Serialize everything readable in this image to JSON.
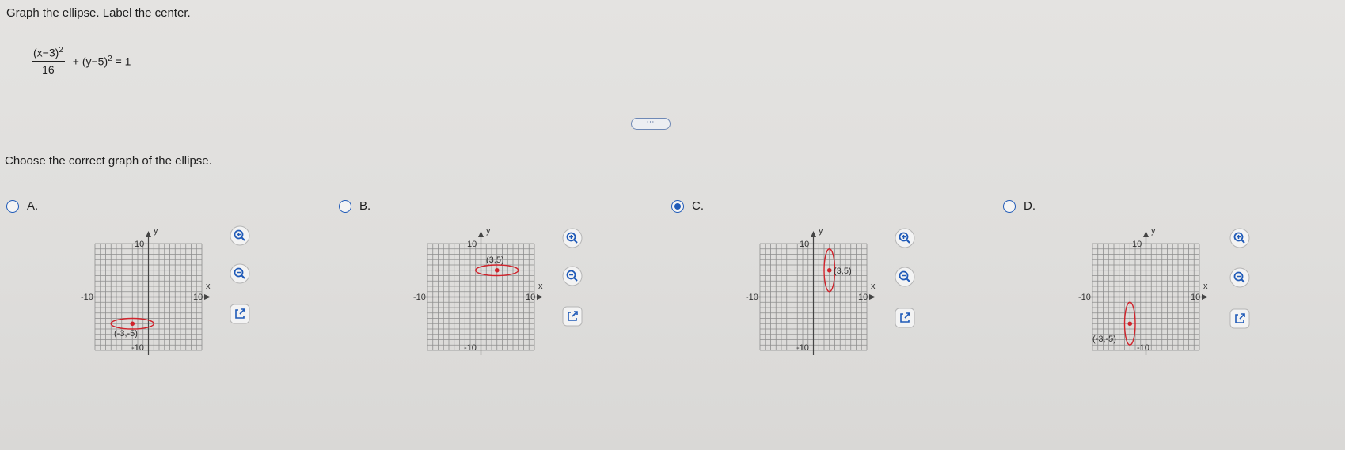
{
  "question": {
    "prompt": "Graph the ellipse. Label the center.",
    "equation": {
      "numerator": "(x−3)",
      "numerator_exp": "2",
      "denominator": "16",
      "rest": "+ (y−5)",
      "rest_exp": "2",
      "equals": "= 1"
    }
  },
  "more_button": "⋯",
  "instruction": "Choose the correct graph of the ellipse.",
  "options": [
    {
      "label": "A.",
      "selected": false,
      "center_label": "(-3,-5)",
      "ticks": {
        "top": "10",
        "bottom": "-10",
        "left": "-10",
        "right": "10"
      }
    },
    {
      "label": "B.",
      "selected": false,
      "center_label": "(3,5)",
      "ticks": {
        "top": "10",
        "bottom": "-10",
        "left": "-10",
        "right": "10"
      }
    },
    {
      "label": "C.",
      "selected": true,
      "center_label": "(3,5)",
      "ticks": {
        "top": "10",
        "bottom": "-10",
        "left": "-10",
        "right": "10"
      }
    },
    {
      "label": "D.",
      "selected": false,
      "center_label": "(-3,-5)",
      "ticks": {
        "top": "10",
        "bottom": "-10",
        "left": "-10",
        "right": "10"
      }
    }
  ],
  "axis_labels": {
    "x": "x",
    "y": "y"
  },
  "tools": [
    "zoom-in-icon",
    "zoom-out-icon",
    "pop-out-icon"
  ],
  "colors": {
    "radio_blue": "#1f5ab8",
    "ellipse_red": "#d0232b",
    "grid_line": "#8e8e8e"
  }
}
